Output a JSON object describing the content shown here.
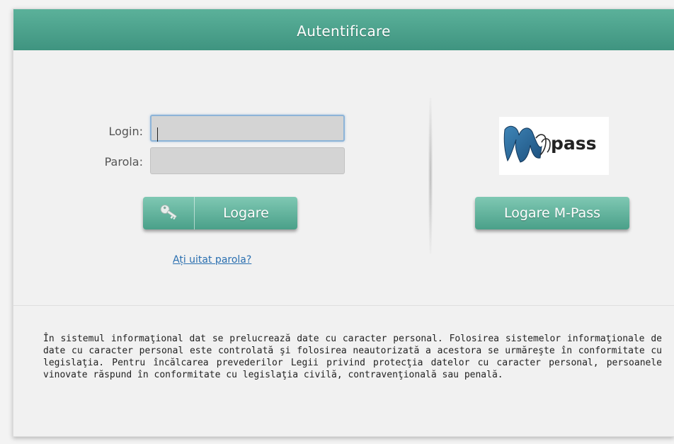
{
  "header": {
    "title": "Autentificare"
  },
  "form": {
    "login_label": "Login:",
    "login_value": "",
    "password_label": "Parola:",
    "password_value": "",
    "login_button_label": "Logare",
    "forgot_password_link": "Ați uitat parola?"
  },
  "mpass": {
    "logo_text": "pass",
    "button_label": "Logare M-Pass"
  },
  "notice": {
    "text": "În sistemul informaţional dat se prelucrează date cu caracter personal. Folosirea sistemelor informaţionale de date cu caracter personal este controlată şi folosirea neautorizată a acestora se urmăreşte în conformitate cu legislaţia. Pentru încălcarea prevederilor Legii privind protecţia datelor cu caracter personal, persoanele vinovate răspund în conformitate cu legislaţia civilă, contravenţională sau penală."
  },
  "colors": {
    "header": "#4fa38e",
    "button": "#5cb39c",
    "link": "#2a6fb0"
  },
  "icons": {
    "login_button_icon": "key-icon",
    "mpass_logo_icon": "mpass-m-icon"
  }
}
